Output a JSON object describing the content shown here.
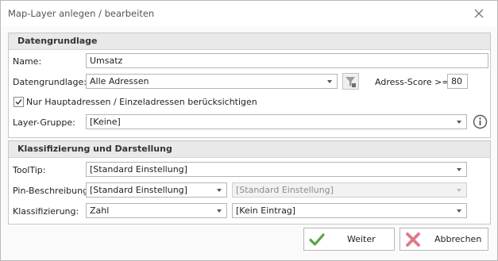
{
  "window": {
    "title": "Map-Layer anlegen / bearbeiten"
  },
  "section1": {
    "title": "Datengrundlage",
    "name_label": "Name:",
    "name_value": "Umsatz",
    "datengrundlage_label": "Datengrundlage:",
    "datengrundlage_value": "Alle Adressen",
    "score_label": "Adress-Score >=",
    "score_value": "80",
    "checkbox_label": "Nur Hauptadressen / Einzeladressen berücksichtigen",
    "checkbox_checked": true,
    "layer_group_label": "Layer-Gruppe:",
    "layer_group_value": "[Keine]"
  },
  "section2": {
    "title": "Klassifizierung und Darstellung",
    "tooltip_label": "ToolTip:",
    "tooltip_value": "[Standard Einstellung]",
    "pin_label": "Pin-Beschreibung:",
    "pin_value": "[Standard Einstellung]",
    "pin_value2": "[Standard Einstellung]",
    "klass_label": "Klassifizierung:",
    "klass_value": "Zahl",
    "klass_value2": "[Kein Eintrag]"
  },
  "buttons": {
    "next": "Weiter",
    "cancel": "Abbrechen"
  },
  "colors": {
    "accent_check": "#5aa34a",
    "cancel_x": "#e0798a"
  },
  "icons": {
    "filter": "filter-icon",
    "info": "info-icon",
    "close": "close-icon",
    "check": "checkmark-icon",
    "cancel": "cross-icon"
  }
}
